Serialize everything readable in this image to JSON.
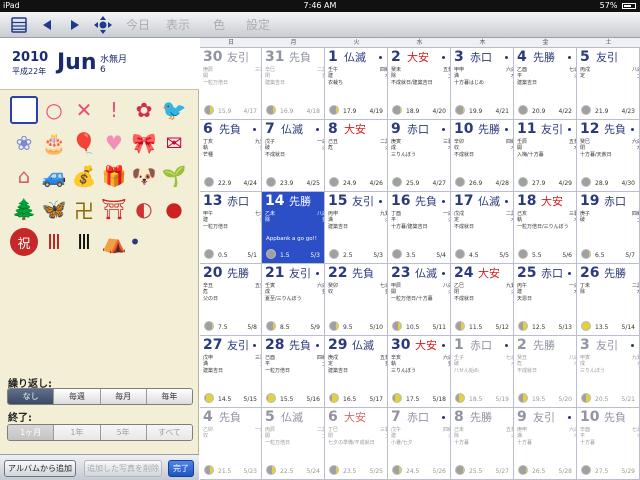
{
  "status": {
    "device": "iPad",
    "time": "7:46 AM",
    "battery": "57%"
  },
  "toolbar": {
    "today": "今日",
    "display": "表示",
    "color": "色",
    "settings": "設定"
  },
  "header": {
    "year": "2010",
    "era": "平成22年",
    "month": "Jun",
    "old_month": "水無月",
    "old_day": "6"
  },
  "stamps": [
    {
      "name": "square-stamp-icon",
      "glyph": "",
      "color": "#2a3fb0"
    },
    {
      "name": "circle-stamp-icon",
      "glyph": "○",
      "color": "#e8507a"
    },
    {
      "name": "cross-stamp-icon",
      "glyph": "✕",
      "color": "#e8507a"
    },
    {
      "name": "exclamation-stamp-icon",
      "glyph": "!",
      "color": "#e8507a"
    },
    {
      "name": "rose-stamp-icon",
      "glyph": "✿",
      "color": "#d82a4a"
    },
    {
      "name": "bird-stamp-icon",
      "glyph": "🐦",
      "color": "#444"
    },
    {
      "name": "hydrangea-stamp-icon",
      "glyph": "❀",
      "color": "#7a8ad8"
    },
    {
      "name": "cake-stamp-icon",
      "glyph": "🎂",
      "color": "#c85"
    },
    {
      "name": "balloon-stamp-icon",
      "glyph": "🎈",
      "color": "#e06"
    },
    {
      "name": "heart-stamp-icon",
      "glyph": "♥",
      "color": "#f28fb8"
    },
    {
      "name": "ribbon-stamp-icon",
      "glyph": "🎀",
      "color": "#e04"
    },
    {
      "name": "letter-stamp-icon",
      "glyph": "✉",
      "color": "#c04"
    },
    {
      "name": "house-stamp-icon",
      "glyph": "⌂",
      "color": "#c66"
    },
    {
      "name": "car-stamp-icon",
      "glyph": "🚙",
      "color": "#2a8"
    },
    {
      "name": "money-bag-stamp-icon",
      "glyph": "💰",
      "color": "#4a4"
    },
    {
      "name": "gift-stamp-icon",
      "glyph": "🎁",
      "color": "#d94"
    },
    {
      "name": "dog-stamp-icon",
      "glyph": "🐶",
      "color": "#a63"
    },
    {
      "name": "sprout-stamp-icon",
      "glyph": "🌱",
      "color": "#3a3"
    },
    {
      "name": "tree-stamp-icon",
      "glyph": "🌲",
      "color": "#285"
    },
    {
      "name": "insect-stamp-icon",
      "glyph": "🦋",
      "color": "#c80"
    },
    {
      "name": "manji-stamp-icon",
      "glyph": "卍",
      "color": "#8a6a00"
    },
    {
      "name": "torii-stamp-icon",
      "glyph": "⛩",
      "color": "#c22"
    },
    {
      "name": "fan-stamp-icon",
      "glyph": "◐",
      "color": "#c33"
    },
    {
      "name": "daruma-stamp-icon",
      "glyph": "●",
      "color": "#c22"
    },
    {
      "name": "celebration-stamp-icon",
      "glyph": "祝",
      "color": "#fff"
    },
    {
      "name": "kujira-curtain-stamp-icon",
      "glyph": "Ⅲ",
      "color": "#b22"
    },
    {
      "name": "mourning-curtain-stamp-icon",
      "glyph": "Ⅲ",
      "color": "#111"
    },
    {
      "name": "shrine-stamp-icon",
      "glyph": "⛺",
      "color": "#b80"
    },
    {
      "name": "dot-stamp-icon",
      "glyph": "•",
      "color": "#2a3a7a"
    }
  ],
  "repeat": {
    "label": "繰り返し:",
    "options": [
      "なし",
      "毎週",
      "毎月",
      "毎年"
    ],
    "selected": 0
  },
  "end": {
    "label": "終了:",
    "options": [
      "1ヶ月",
      "1年",
      "5年",
      "すべて"
    ],
    "selected": 0
  },
  "bottom": {
    "album_add": "アルバムから追加",
    "remove_photo": "追加した写真を削除",
    "done": "完了"
  },
  "weekdays": [
    "日",
    "月",
    "火",
    "水",
    "木",
    "金",
    "土"
  ],
  "colors": {
    "accent": "#2c4fc7",
    "number": "#2a3a7a",
    "red": "#d42020"
  },
  "weeks": [
    [
      {
        "d": "30",
        "r": "友引",
        "other": true,
        "l": [
          [
            "庚辰",
            "三碧"
          ],
          [
            "開",
            "木"
          ],
          [
            "一粒万倍日"
          ]
        ],
        "age": "15.9",
        "lunar": "4/17",
        "ph": 0.5
      },
      {
        "d": "31",
        "r": "先負",
        "other": true,
        "l": [
          [
            "辛巳",
            "二黒"
          ],
          [
            "閉",
            "金"
          ],
          [
            "建築吉日"
          ]
        ],
        "age": "16.9",
        "lunar": "4/18",
        "ph": 0.45
      },
      {
        "d": "1",
        "r": "仏滅",
        "dot": true,
        "l": [
          [
            "壬午",
            "四緑"
          ],
          [
            "建",
            "木"
          ],
          [
            "衣裁ち"
          ]
        ],
        "age": "17.9",
        "lunar": "4/19",
        "ph": 0.4
      },
      {
        "d": "2",
        "r": "大安",
        "red": true,
        "dot": true,
        "l": [
          [
            "癸未",
            "五黄"
          ],
          [
            "除",
            "土"
          ],
          [
            "不成就日/建築吉日"
          ]
        ],
        "age": "18.9",
        "lunar": "4/20",
        "ph": 0.35
      },
      {
        "d": "3",
        "r": "赤口",
        "dot": true,
        "l": [
          [
            "甲申",
            "六白"
          ],
          [
            "満",
            "水"
          ],
          [
            "十方暮はじめ"
          ]
        ],
        "age": "19.9",
        "lunar": "4/21",
        "ph": 0.3
      },
      {
        "d": "4",
        "r": "先勝",
        "dot": true,
        "l": [
          [
            "乙酉",
            "七赤"
          ],
          [
            "平",
            "火"
          ],
          [
            "建築吉日"
          ]
        ],
        "age": "20.9",
        "lunar": "4/22",
        "ph": 0.25
      },
      {
        "d": "5",
        "r": "友引",
        "l": [
          [
            "丙戌",
            "八白"
          ],
          [
            "定",
            "土"
          ],
          [
            ""
          ]
        ],
        "age": "21.9",
        "lunar": "4/23",
        "ph": 0.2
      }
    ],
    [
      {
        "d": "6",
        "r": "先負",
        "dot": true,
        "l": [
          [
            "丁亥",
            "九紫"
          ],
          [
            "執",
            "金"
          ],
          [
            "芒種"
          ]
        ],
        "age": "22.9",
        "lunar": "4/24",
        "ph": 0.15
      },
      {
        "d": "7",
        "r": "仏滅",
        "dot": true,
        "l": [
          [
            "戊子",
            "一白"
          ],
          [
            "破",
            "火"
          ],
          [
            "不成就日"
          ]
        ],
        "age": "23.9",
        "lunar": "4/25",
        "ph": 0.1
      },
      {
        "d": "8",
        "r": "大安",
        "red": true,
        "l": [
          [
            "己丑",
            "二黒"
          ],
          [
            "危",
            "火"
          ],
          [
            ""
          ]
        ],
        "age": "24.9",
        "lunar": "4/26",
        "ph": 0.08
      },
      {
        "d": "9",
        "r": "赤口",
        "dot": true,
        "l": [
          [
            "庚寅",
            "三碧"
          ],
          [
            "成",
            "木"
          ],
          [
            "三りんぼう"
          ]
        ],
        "age": "25.9",
        "lunar": "4/27",
        "ph": 0.06
      },
      {
        "d": "10",
        "r": "先勝",
        "dbl": true,
        "dot": true,
        "l": [
          [
            "辛卯",
            "四緑"
          ],
          [
            "収",
            "木"
          ],
          [
            "不成就日"
          ]
        ],
        "age": "26.9",
        "lunar": "4/28",
        "ph": 0.04
      },
      {
        "d": "11",
        "r": "友引",
        "dbl": true,
        "dot": true,
        "l": [
          [
            "壬辰",
            "五黄"
          ],
          [
            "開",
            "水"
          ],
          [
            "入梅/十方暮"
          ]
        ],
        "age": "27.9",
        "lunar": "4/29",
        "ph": 0.02
      },
      {
        "d": "12",
        "r": "先負",
        "dbl": true,
        "dot": true,
        "l": [
          [
            "癸巳",
            "六白"
          ],
          [
            "閉",
            "水"
          ],
          [
            "十方暮/天赦日"
          ]
        ],
        "age": "28.9",
        "lunar": "4/30",
        "ph": 0
      }
    ],
    [
      {
        "d": "13",
        "r": "赤口",
        "dbl": true,
        "l": [
          [
            "甲午",
            "七赤"
          ],
          [
            "建",
            "金"
          ],
          [
            "一粒万倍日"
          ]
        ],
        "age": "0.5",
        "lunar": "5/1",
        "ph": 0.02
      },
      {
        "d": "14",
        "r": "先勝",
        "dbl": true,
        "sel": true,
        "memo": "Appbank a go go!!",
        "l": [
          [
            "乙未",
            "八白"
          ],
          [
            "除",
            "金"
          ],
          [
            ""
          ]
        ],
        "age": "1.5",
        "lunar": "5/3",
        "ph": 0.05
      },
      {
        "d": "15",
        "r": "友引",
        "dbl": true,
        "dot": true,
        "l": [
          [
            "丙申",
            "九紫"
          ],
          [
            "満",
            "火"
          ],
          [
            "建築吉日"
          ]
        ],
        "age": "2.5",
        "lunar": "5/3",
        "ph": 0.08
      },
      {
        "d": "16",
        "r": "先負",
        "dbl": true,
        "dot": true,
        "l": [
          [
            "丁酉",
            "一白"
          ],
          [
            "平",
            "火"
          ],
          [
            "十方暮/建築吉日"
          ]
        ],
        "age": "3.5",
        "lunar": "5/4",
        "ph": 0.12
      },
      {
        "d": "17",
        "r": "仏滅",
        "dbl": true,
        "dot": true,
        "l": [
          [
            "戊戌",
            "二黒"
          ],
          [
            "定",
            "木"
          ],
          [
            "不成就日"
          ]
        ],
        "age": "4.5",
        "lunar": "5/5",
        "ph": 0.18
      },
      {
        "d": "18",
        "r": "大安",
        "dbl": true,
        "red": true,
        "l": [
          [
            "己亥",
            "三碧"
          ],
          [
            "執",
            "木"
          ],
          [
            "一粒万倍日/三りんぼう"
          ]
        ],
        "age": "5.5",
        "lunar": "5/6",
        "ph": 0.25
      },
      {
        "d": "19",
        "r": "赤口",
        "dbl": true,
        "l": [
          [
            "庚子",
            "四緑"
          ],
          [
            "破",
            "土"
          ],
          [
            ""
          ]
        ],
        "age": "6.5",
        "lunar": "5/7",
        "ph": 0.3
      }
    ],
    [
      {
        "d": "20",
        "r": "先勝",
        "dbl": true,
        "l": [
          [
            "辛丑",
            "五黄"
          ],
          [
            "危",
            "土"
          ],
          [
            "父の日"
          ]
        ],
        "age": "7.5",
        "lunar": "5/8",
        "ph": 0.35
      },
      {
        "d": "21",
        "r": "友引",
        "dbl": true,
        "dot": true,
        "l": [
          [
            "壬寅",
            "六白"
          ],
          [
            "成",
            "金"
          ],
          [
            "夏至/三りんぼう"
          ]
        ],
        "age": "8.5",
        "lunar": "5/9",
        "ph": 0.4
      },
      {
        "d": "22",
        "r": "先負",
        "dbl": true,
        "l": [
          [
            "癸卯",
            "七赤"
          ],
          [
            "収",
            "金"
          ],
          [
            ""
          ]
        ],
        "age": "9.5",
        "lunar": "5/10",
        "ph": 0.45
      },
      {
        "d": "23",
        "r": "仏滅",
        "dbl": true,
        "dot": true,
        "l": [
          [
            "甲辰",
            "八白"
          ],
          [
            "開",
            "火"
          ],
          [
            "一粒万倍日/十方暮"
          ]
        ],
        "age": "10.5",
        "lunar": "5/11",
        "ph": 0.5
      },
      {
        "d": "24",
        "r": "大安",
        "dbl": true,
        "red": true,
        "l": [
          [
            "乙巳",
            "九紫"
          ],
          [
            "閉",
            "火"
          ],
          [
            "不成就日"
          ]
        ],
        "age": "11.5",
        "lunar": "5/12",
        "ph": 0.55
      },
      {
        "d": "25",
        "r": "赤口",
        "dbl": true,
        "dot": true,
        "l": [
          [
            "丙午",
            "一白"
          ],
          [
            "建",
            "水"
          ],
          [
            "天恩日"
          ]
        ],
        "age": "12.5",
        "lunar": "5/13",
        "ph": 0.6
      },
      {
        "d": "26",
        "r": "先勝",
        "dbl": true,
        "l": [
          [
            "丁未",
            "二黒"
          ],
          [
            "除",
            "水"
          ],
          [
            ""
          ]
        ],
        "age": "13.5",
        "lunar": "5/14",
        "ph": 1
      }
    ],
    [
      {
        "d": "27",
        "r": "友引",
        "dbl": true,
        "dot": true,
        "l": [
          [
            "戊申",
            "三碧"
          ],
          [
            "満",
            "土"
          ],
          [
            "建築吉日"
          ]
        ],
        "age": "14.5",
        "lunar": "5/15",
        "ph": 0.95
      },
      {
        "d": "28",
        "r": "先負",
        "dbl": true,
        "dot": true,
        "l": [
          [
            "己酉",
            "四緑"
          ],
          [
            "平",
            "土"
          ],
          [
            "一粒万倍日"
          ]
        ],
        "age": "15.5",
        "lunar": "5/16",
        "ph": 0.9
      },
      {
        "d": "29",
        "r": "仏滅",
        "dbl": true,
        "l": [
          [
            "庚戌",
            "五黄"
          ],
          [
            "定",
            "金"
          ],
          [
            "建築吉日"
          ]
        ],
        "age": "16.5",
        "lunar": "5/17",
        "ph": 0.85
      },
      {
        "d": "30",
        "r": "大安",
        "dbl": true,
        "red": true,
        "dot": true,
        "l": [
          [
            "辛亥",
            "六白"
          ],
          [
            "執",
            "金"
          ],
          [
            "三りんぼう"
          ]
        ],
        "age": "17.5",
        "lunar": "5/18",
        "ph": 0.8
      },
      {
        "d": "1",
        "r": "赤口",
        "other": true,
        "dot": true,
        "l": [
          [
            "壬子",
            "七赤"
          ],
          [
            "破",
            "木"
          ],
          [
            "八せん始め"
          ]
        ],
        "age": "18.5",
        "lunar": "5/19",
        "ph": 0.7
      },
      {
        "d": "2",
        "r": "先勝",
        "other": true,
        "l": [
          [
            "癸丑",
            "八白"
          ],
          [
            "危",
            "木"
          ],
          [
            "不成就日"
          ]
        ],
        "age": "19.5",
        "lunar": "5/20",
        "ph": 0.65
      },
      {
        "d": "3",
        "r": "友引",
        "other": true,
        "dot": true,
        "l": [
          [
            "甲寅",
            "九紫"
          ],
          [
            "成",
            "水"
          ],
          [
            "三りんぼう"
          ]
        ],
        "age": "20.5",
        "lunar": "5/21",
        "ph": 0.6
      }
    ],
    [
      {
        "d": "4",
        "r": "先負",
        "other": true,
        "l": [
          [
            "乙卯",
            "一白"
          ],
          [
            "収",
            "水"
          ],
          [
            ""
          ]
        ],
        "age": "21.5",
        "lunar": "5/23",
        "ph": 0.55
      },
      {
        "d": "5",
        "r": "仏滅",
        "other": true,
        "l": [
          [
            "丙辰",
            "二黒"
          ],
          [
            "開",
            "土"
          ],
          [
            "一粒万倍日"
          ]
        ],
        "age": "22.5",
        "lunar": "5/24",
        "ph": 0.5
      },
      {
        "d": "6",
        "r": "大安",
        "other": true,
        "red": true,
        "l": [
          [
            "丁巳",
            "三碧"
          ],
          [
            "閉",
            "土"
          ],
          [
            "七夕の準備/不成就日"
          ]
        ],
        "age": "23.5",
        "lunar": "5/25",
        "ph": 0.45
      },
      {
        "d": "7",
        "r": "赤口",
        "other": true,
        "dot": true,
        "l": [
          [
            "戊午",
            "四緑"
          ],
          [
            "建",
            "火"
          ],
          [
            "小暑/七夕"
          ]
        ],
        "age": "24.5",
        "lunar": "5/26",
        "ph": 0.4
      },
      {
        "d": "8",
        "r": "先勝",
        "other": true,
        "l": [
          [
            "己未",
            "五黄"
          ],
          [
            "除",
            "火"
          ],
          [
            "十方暮"
          ]
        ],
        "age": "25.5",
        "lunar": "5/27",
        "ph": 0.35
      },
      {
        "d": "9",
        "r": "友引",
        "other": true,
        "dot": true,
        "l": [
          [
            "庚申",
            "六白"
          ],
          [
            "満",
            "木"
          ],
          [
            "十方暮"
          ]
        ],
        "age": "26.5",
        "lunar": "5/28",
        "ph": 0.3
      },
      {
        "d": "10",
        "r": "先負",
        "dbl": true,
        "other": true,
        "l": [
          [
            "辛酉",
            "七赤"
          ],
          [
            "平",
            "木"
          ],
          [
            "十方暮"
          ]
        ],
        "age": "27.5",
        "lunar": "5/29",
        "ph": 0.25
      }
    ]
  ]
}
